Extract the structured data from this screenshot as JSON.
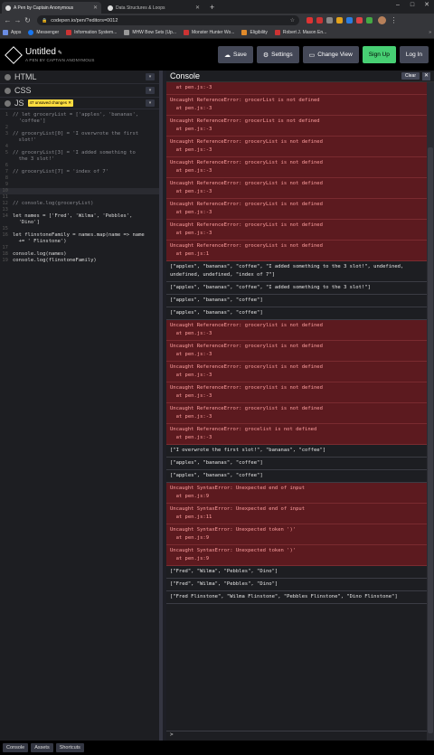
{
  "browser": {
    "tabs": [
      {
        "label": "A Pen by Captain Anonymous",
        "active": true
      },
      {
        "label": "Data Structures & Loops",
        "active": false
      }
    ],
    "url": "codepen.io/pen/?editors=0012",
    "bookmarks": [
      {
        "label": "Apps",
        "color": "#6b8de3"
      },
      {
        "label": "Messenger",
        "color": "#1877f2"
      },
      {
        "label": "Information System...",
        "color": "#c33"
      },
      {
        "label": "MHW Bow Sets (Up...",
        "color": "#999"
      },
      {
        "label": "Monster Hunter Wo...",
        "color": "#c33"
      },
      {
        "label": "Eligibility",
        "color": "#e08a2b"
      },
      {
        "label": "Robert J. Mason En...",
        "color": "#c33"
      }
    ]
  },
  "codepen": {
    "title": "Untitled",
    "subtitle": "A PEN BY CAPTAIN ANONYMOUS",
    "buttons": {
      "save": "Save",
      "settings": "Settings",
      "change_view": "Change View",
      "signup": "Sign Up",
      "login": "Log In"
    },
    "panels": {
      "html": "HTML",
      "css": "CSS",
      "js": "JS",
      "unsaved_badge": "47 unsaved changes ✕"
    },
    "code_lines": [
      {
        "n": "1",
        "t": "// let groceryList = ['apples', 'bananas',",
        "c": "cmt"
      },
      {
        "n": "",
        "t": "  'coffee']",
        "c": "cmt"
      },
      {
        "n": "2",
        "t": "",
        "c": ""
      },
      {
        "n": "3",
        "t": "// groceryList[0] = 'I overwrote the first",
        "c": "cmt"
      },
      {
        "n": "",
        "t": "  slot!'",
        "c": "cmt"
      },
      {
        "n": "4",
        "t": "",
        "c": ""
      },
      {
        "n": "5",
        "t": "// groceryList[3] = 'I added something to",
        "c": "cmt"
      },
      {
        "n": "",
        "t": "  the 3 slot!'",
        "c": "cmt"
      },
      {
        "n": "6",
        "t": "",
        "c": ""
      },
      {
        "n": "7",
        "t": "// groceryList[7] = 'index of 7'",
        "c": "cmt"
      },
      {
        "n": "8",
        "t": "",
        "c": ""
      },
      {
        "n": "9",
        "t": "",
        "c": ""
      },
      {
        "n": "10",
        "t": "",
        "c": "hl"
      },
      {
        "n": "11",
        "t": "",
        "c": ""
      },
      {
        "n": "12",
        "t": "// console.log(groceryList)",
        "c": "cmt"
      },
      {
        "n": "13",
        "t": "",
        "c": ""
      },
      {
        "n": "14",
        "t": "let names = ['Fred', 'Wilma', 'Pebbles',",
        "c": "code"
      },
      {
        "n": "",
        "t": "  'Dino']",
        "c": "code"
      },
      {
        "n": "15",
        "t": "",
        "c": ""
      },
      {
        "n": "16",
        "t": "let flinstoneFamily = names.map(name => name",
        "c": "code"
      },
      {
        "n": "",
        "t": "  += ' Flinstone')",
        "c": "code"
      },
      {
        "n": "17",
        "t": "",
        "c": ""
      },
      {
        "n": "18",
        "t": "console.log(names)",
        "c": "code"
      },
      {
        "n": "19",
        "t": "console.log(flinstoneFamily)",
        "c": "code"
      }
    ],
    "footer": [
      "Console",
      "Assets",
      "Shortcuts"
    ]
  },
  "console": {
    "title": "Console",
    "clear_label": "Clear",
    "close_label": "✕",
    "prompt": ">",
    "entries": [
      {
        "type": "err",
        "lines": [
          "  at pen.js:-3"
        ]
      },
      {
        "type": "err",
        "lines": [
          "Uncaught ReferenceError: grocerList is not defined",
          "  at pen.js:-3"
        ]
      },
      {
        "type": "err",
        "lines": [
          "Uncaught ReferenceError: grocerList is not defined",
          "  at pen.js:-3"
        ]
      },
      {
        "type": "err",
        "lines": [
          "Uncaught ReferenceError: groceryList is not defined",
          "  at pen.js:-3"
        ]
      },
      {
        "type": "err",
        "lines": [
          "Uncaught ReferenceError: groceryList is not defined",
          "  at pen.js:-3"
        ]
      },
      {
        "type": "err",
        "lines": [
          "Uncaught ReferenceError: groceryList is not defined",
          "  at pen.js:-3"
        ]
      },
      {
        "type": "err",
        "lines": [
          "Uncaught ReferenceError: groceryList is not defined",
          "  at pen.js:-3"
        ]
      },
      {
        "type": "err",
        "lines": [
          "Uncaught ReferenceError: groceryList is not defined",
          "  at pen.js:-3"
        ]
      },
      {
        "type": "err",
        "lines": [
          "Uncaught ReferenceError: groceryList is not defined",
          "  at pen.js:1"
        ]
      },
      {
        "type": "log",
        "lines": [
          "[\"apples\", \"bananas\", \"coffee\", \"I added something to the 3 slot!\", undefined,",
          "undefined, undefined, \"index of 7\"]"
        ]
      },
      {
        "type": "log",
        "lines": [
          "[\"apples\", \"bananas\", \"coffee\", \"I added something to the 3 slot!\"]"
        ]
      },
      {
        "type": "log",
        "lines": [
          "[\"apples\", \"bananas\", \"coffee\"]"
        ]
      },
      {
        "type": "log",
        "lines": [
          "[\"apples\", \"bananas\", \"coffee\"]"
        ]
      },
      {
        "type": "err",
        "lines": [
          "Uncaught ReferenceError: grocerylist is not defined",
          "  at pen.js:-3"
        ]
      },
      {
        "type": "err",
        "lines": [
          "Uncaught ReferenceError: grocerylist is not defined",
          "  at pen.js:-3"
        ]
      },
      {
        "type": "err",
        "lines": [
          "Uncaught ReferenceError: grocerylist is not defined",
          "  at pen.js:-3"
        ]
      },
      {
        "type": "err",
        "lines": [
          "Uncaught ReferenceError: grocerylist is not defined",
          "  at pen.js:-3"
        ]
      },
      {
        "type": "err",
        "lines": [
          "Uncaught ReferenceError: grocerylist is not defined",
          "  at pen.js:-3"
        ]
      },
      {
        "type": "err",
        "lines": [
          "Uncaught ReferenceError: grocelist is not defined",
          "  at pen.js:-3"
        ]
      },
      {
        "type": "log",
        "lines": [
          "[\"I overwrote the first slot!\", \"bananas\", \"coffee\"]"
        ]
      },
      {
        "type": "log",
        "lines": [
          "[\"apples\", \"bananas\", \"coffee\"]"
        ]
      },
      {
        "type": "log",
        "lines": [
          "[\"apples\", \"bananas\", \"coffee\"]"
        ]
      },
      {
        "type": "err",
        "lines": [
          "Uncaught SyntaxError: Unexpected end of input",
          "  at pen.js:9"
        ]
      },
      {
        "type": "err",
        "lines": [
          "Uncaught SyntaxError: Unexpected end of input",
          "  at pen.js:11"
        ]
      },
      {
        "type": "err",
        "lines": [
          "Uncaught SyntaxError: Unexpected token ')'",
          "  at pen.js:9"
        ]
      },
      {
        "type": "err",
        "lines": [
          "Uncaught SyntaxError: Unexpected token ')'",
          "  at pen.js:9"
        ]
      },
      {
        "type": "log",
        "lines": [
          "[\"Fred\", \"Wilma\", \"Pebbles\", \"Dino\"]"
        ]
      },
      {
        "type": "log",
        "lines": [
          "[\"Fred\", \"Wilma\", \"Pebbles\", \"Dino\"]"
        ]
      },
      {
        "type": "log",
        "lines": [
          "[\"Fred Flinstone\", \"Wilma Flinstone\", \"Pebbles Flinstone\", \"Dino Flinstone\"]"
        ]
      }
    ]
  }
}
